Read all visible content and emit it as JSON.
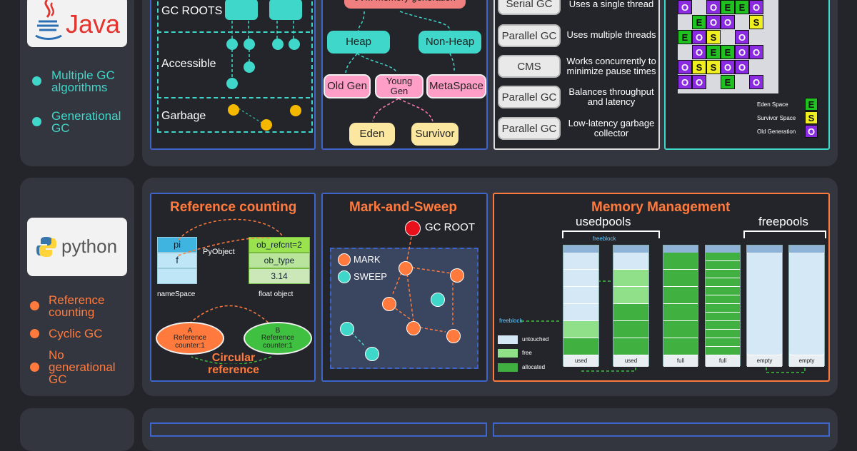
{
  "colors": {
    "teal": "#3fd7c9",
    "orange": "#ff7a3c",
    "blue_border": "#3d64c8",
    "bg": "#24252b",
    "card": "#34363f",
    "green": "#20c020",
    "yellow": "#f0f020",
    "purple": "#8a2be2"
  },
  "java": {
    "logo": "Java",
    "bullets": [
      "Multiple GC algorithms",
      "Generational GC"
    ],
    "gc_panel": {
      "roots": "GC ROOTS",
      "accessible": "Accessible",
      "garbage": "Garbage"
    },
    "gen_panel": {
      "title": "JVM memory generation",
      "heap": "Heap",
      "nonheap": "Non-Heap",
      "oldgen": "Old Gen",
      "younggen": "Young Gen",
      "metaspace": "MetaSpace",
      "eden": "Eden",
      "survivor": "Survivor"
    },
    "gc_types": [
      {
        "name": "Serial GC",
        "desc": "Uses a single thread"
      },
      {
        "name": "Parallel GC",
        "desc": "Uses multiple threads"
      },
      {
        "name": "CMS",
        "desc": "Works concurrently to minimize pause times"
      },
      {
        "name": "Parallel GC",
        "desc": "Balances throughput and latency"
      },
      {
        "name": "Parallel GC",
        "desc": "Low-latency garbage collector"
      }
    ],
    "grid": {
      "rows": [
        [
          "O",
          "",
          "O",
          "E",
          "E",
          "O",
          ""
        ],
        [
          "",
          "E",
          "O",
          "O",
          "",
          "S",
          ""
        ],
        [
          "E",
          "O",
          "S",
          "",
          "O",
          "",
          ""
        ],
        [
          "",
          "O",
          "E",
          "E",
          "O",
          "O",
          ""
        ],
        [
          "O",
          "S",
          "S",
          "O",
          "O",
          "",
          ""
        ],
        [
          "O",
          "O",
          "",
          "E",
          "",
          "O",
          ""
        ]
      ],
      "legend": [
        {
          "label": "Eden Space",
          "code": "E"
        },
        {
          "label": "Survivor Space",
          "code": "S"
        },
        {
          "label": "Old Generation",
          "code": "O"
        }
      ]
    }
  },
  "python": {
    "logo": "python",
    "bullets": [
      "Reference counting",
      "Cyclic GC",
      "No generational GC"
    ],
    "refcount": {
      "title": "Reference counting",
      "ns": [
        "pi",
        "f",
        ""
      ],
      "pyobject": "PyObject",
      "fields": [
        "ob_refcnt=2",
        "ob_type",
        "3.14"
      ],
      "namespace": "nameSpace",
      "floatobj": "float object",
      "a_label": "A",
      "b_label": "B",
      "counter": "Reference counter:1",
      "circular": "Circular reference"
    },
    "marksweep": {
      "title": "Mark-and-Sweep",
      "root": "GC ROOT",
      "mark": "MARK",
      "sweep": "SWEEP"
    },
    "memory": {
      "title": "Memory Management",
      "usedpools": "usedpools",
      "freepools": "freepools",
      "freeblock": "freeblock",
      "legend": [
        "untouched",
        "free",
        "allocated"
      ],
      "cols": [
        "used",
        "used",
        "full",
        "full",
        "empty",
        "empty"
      ]
    }
  }
}
